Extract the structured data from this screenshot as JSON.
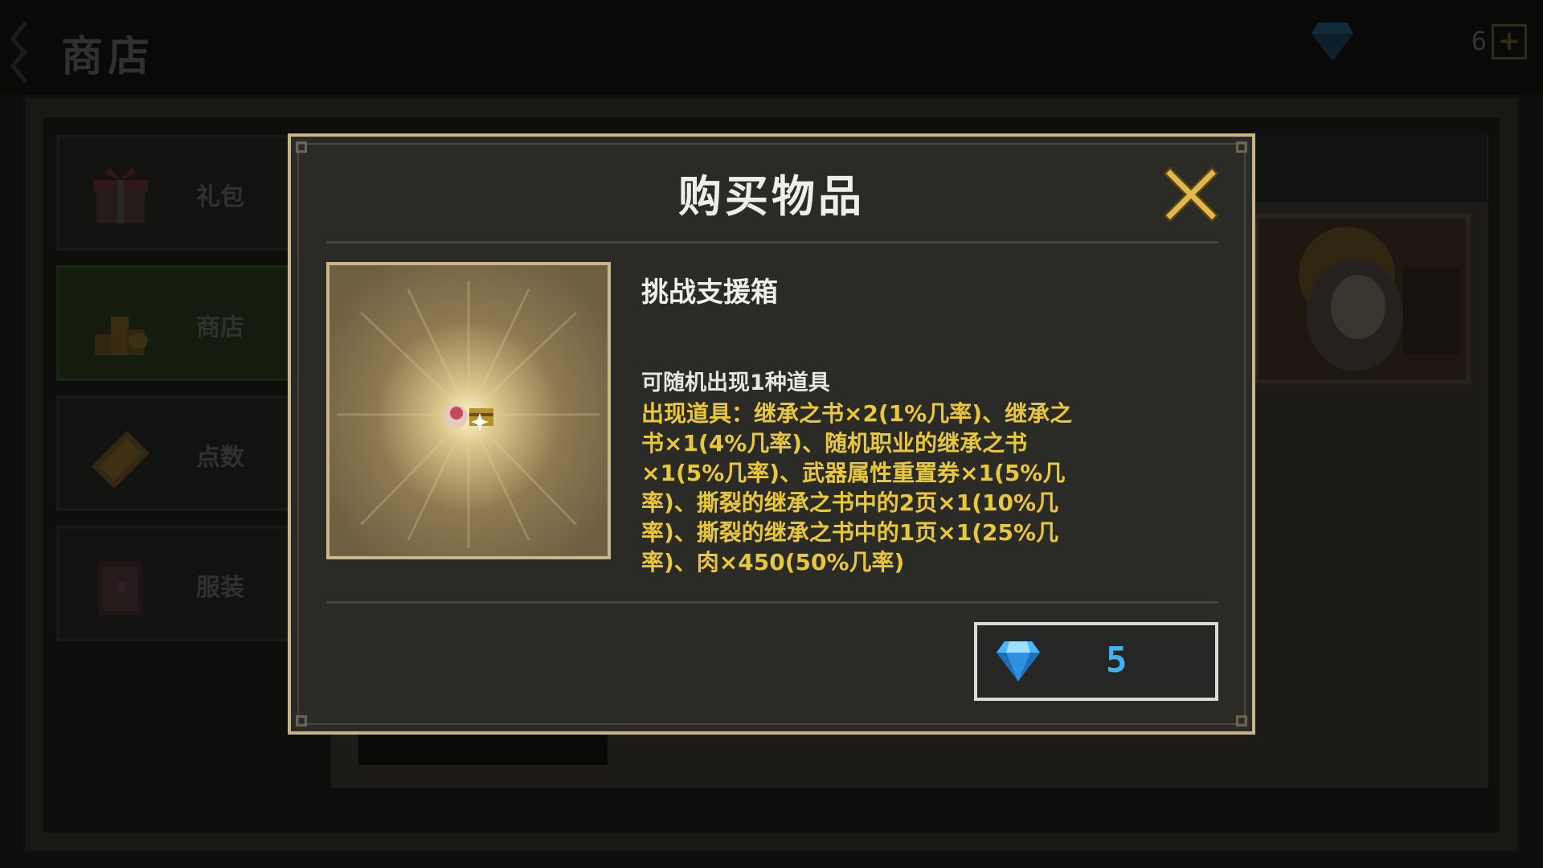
{
  "screen": {
    "title": "商店",
    "currency": {
      "icon": "diamond-icon",
      "count": "6",
      "plus": "+"
    }
  },
  "side_menu": {
    "items": [
      {
        "label": "礼包",
        "icon": "gift-icon",
        "active": false
      },
      {
        "label": "商店",
        "icon": "coin-stack-icon",
        "active": true
      },
      {
        "label": "点数",
        "icon": "ticket-icon",
        "active": false
      },
      {
        "label": "服装",
        "icon": "wardrobe-icon",
        "active": false
      }
    ]
  },
  "modal": {
    "title": "购买物品",
    "item": {
      "name": "挑战支援箱",
      "note": "可随机出现1种道具",
      "description": "出现道具：继承之书×2(1%几率)、继承之书×1(4%几率)、随机职业的继承之书×1(5%几率)、武器属性重置券×1(5%几率)、撕裂的继承之书中的2页×1(10%几率)、撕裂的继承之书中的1页×1(25%几率)、肉×450(50%几率)"
    },
    "price": {
      "icon": "diamond-icon",
      "value": "5"
    }
  },
  "colors": {
    "accent_gold": "#e9c73a",
    "frame_tan": "#c9b48a",
    "gem_blue": "#3fb4ef",
    "close_gold": "#e0b84e"
  }
}
